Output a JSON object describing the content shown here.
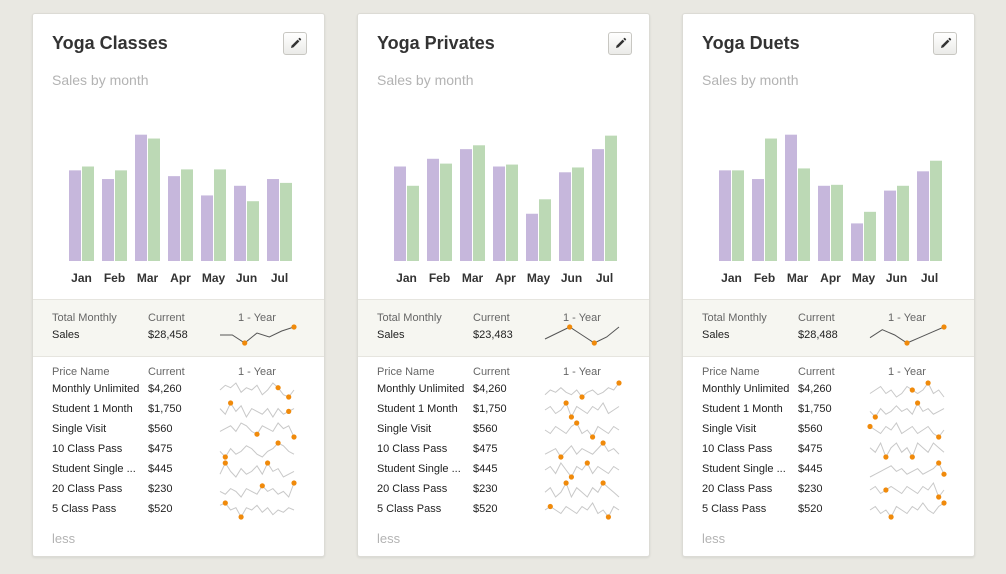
{
  "colors": {
    "current_bar": "#c6b7dc",
    "previous_bar": "#bcd9b5",
    "spark_line": "#555555",
    "spark_line_light": "#c8c8c8",
    "spark_dot": "#f08a0b"
  },
  "icons": {
    "edit": "pencil-icon"
  },
  "cards": [
    {
      "title": "Yoga Classes",
      "subtitle": "Sales by month",
      "chart_data": {
        "type": "bar",
        "categories": [
          "Jan",
          "Feb",
          "Mar",
          "Apr",
          "May",
          "Jun",
          "Jul"
        ],
        "series": [
          {
            "values": [
              94,
              85,
              131,
              88,
              68,
              78,
              85
            ]
          },
          {
            "values": [
              98,
              94,
              127,
              95,
              95,
              62,
              81
            ]
          }
        ],
        "ylim": [
          0,
          140
        ]
      },
      "summary": {
        "label_line1": "Total Monthly",
        "label_line2": "Sales",
        "current_header": "Current",
        "current_value": "$28,458",
        "trend_header": "1 - Year",
        "trend": [
          6,
          6,
          2,
          7,
          5,
          8,
          10
        ]
      },
      "price_list": {
        "name_header": "Price Name",
        "current_header": "Current",
        "trend_header": "1 - Year",
        "rows": [
          {
            "name": "Monthly Unlimited",
            "value": "$4,260",
            "trend": [
              5,
              7,
              6,
              8,
              4,
              6,
              5,
              7,
              3,
              5,
              8,
              6,
              3,
              2,
              5
            ],
            "highlight": [
              11,
              13
            ]
          },
          {
            "name": "Student 1 Month",
            "value": "$1,750",
            "trend": [
              6,
              4,
              8,
              5,
              7,
              3,
              6,
              5,
              4,
              6,
              3,
              6,
              4,
              5,
              6
            ],
            "highlight": [
              2,
              13
            ]
          },
          {
            "name": "Single Visit",
            "value": "$560",
            "trend": [
              4,
              5,
              6,
              4,
              7,
              6,
              4,
              3,
              6,
              5,
              4,
              7,
              5,
              6,
              2
            ],
            "highlight": [
              7,
              14
            ]
          },
          {
            "name": "10 Class Pass",
            "value": "$475",
            "trend": [
              5,
              3,
              6,
              4,
              5,
              7,
              6,
              4,
              3,
              5,
              6,
              8,
              7,
              5,
              4
            ],
            "highlight": [
              1,
              11
            ]
          },
          {
            "name": "Student Single ...",
            "value": "$445",
            "trend": [
              4,
              8,
              5,
              3,
              6,
              4,
              5,
              7,
              4,
              8,
              5,
              6,
              3,
              4,
              5
            ],
            "highlight": [
              1,
              9
            ]
          },
          {
            "name": "20 Class Pass",
            "value": "$230",
            "trend": [
              5,
              4,
              6,
              5,
              3,
              6,
              5,
              4,
              7,
              5,
              6,
              4,
              5,
              3,
              8
            ],
            "highlight": [
              8,
              14
            ]
          },
          {
            "name": "5 Class Pass",
            "value": "$520",
            "trend": [
              7,
              8,
              5,
              6,
              2,
              6,
              5,
              7,
              4,
              6,
              3,
              5,
              4,
              6,
              5
            ],
            "highlight": [
              4,
              1
            ]
          }
        ]
      },
      "less_label": "less"
    },
    {
      "title": "Yoga Privates",
      "subtitle": "Sales by month",
      "chart_data": {
        "type": "bar",
        "categories": [
          "Jan",
          "Feb",
          "Mar",
          "Apr",
          "May",
          "Jun",
          "Jul"
        ],
        "series": [
          {
            "values": [
              98,
              106,
              116,
              98,
              49,
              92,
              116
            ]
          },
          {
            "values": [
              78,
              101,
              120,
              100,
              64,
              97,
              130
            ]
          }
        ],
        "ylim": [
          0,
          140
        ]
      },
      "summary": {
        "label_line1": "Total Monthly",
        "label_line2": "Sales",
        "current_header": "Current",
        "current_value": "$23,483",
        "trend_header": "1 - Year",
        "trend": [
          4,
          7,
          10,
          6,
          2,
          5,
          10
        ]
      },
      "price_list": {
        "name_header": "Price Name",
        "current_header": "Current",
        "trend_header": "1 - Year",
        "rows": [
          {
            "name": "Monthly Unlimited",
            "value": "$4,260",
            "trend": [
              4,
              6,
              5,
              7,
              5,
              4,
              6,
              3,
              5,
              6,
              4,
              5,
              7,
              6,
              9
            ],
            "highlight": [
              14,
              7
            ]
          },
          {
            "name": "Student 1 Month",
            "value": "$1,750",
            "trend": [
              5,
              6,
              4,
              5,
              7,
              3,
              6,
              5,
              4,
              6,
              5,
              7,
              4,
              5,
              6
            ],
            "highlight": [
              5,
              4
            ]
          },
          {
            "name": "Single Visit",
            "value": "$560",
            "trend": [
              5,
              4,
              6,
              5,
              4,
              6,
              7,
              4,
              5,
              3,
              6,
              5,
              4,
              6,
              5
            ],
            "highlight": [
              6,
              9
            ]
          },
          {
            "name": "10 Class Pass",
            "value": "$475",
            "trend": [
              4,
              5,
              6,
              3,
              5,
              7,
              4,
              6,
              5,
              4,
              6,
              8,
              5,
              6,
              4
            ],
            "highlight": [
              3,
              11
            ]
          },
          {
            "name": "Student Single ...",
            "value": "$445",
            "trend": [
              5,
              6,
              4,
              7,
              5,
              3,
              6,
              5,
              7,
              4,
              6,
              5,
              4,
              6,
              5
            ],
            "highlight": [
              5,
              8
            ]
          },
          {
            "name": "20 Class Pass",
            "value": "$230",
            "trend": [
              5,
              6,
              4,
              5,
              7,
              4,
              6,
              5,
              4,
              6,
              5,
              7,
              6,
              5,
              4
            ],
            "highlight": [
              4,
              11
            ]
          },
          {
            "name": "5 Class Pass",
            "value": "$520",
            "trend": [
              5,
              6,
              5,
              4,
              6,
              5,
              4,
              6,
              5,
              7,
              4,
              5,
              3,
              6,
              5
            ],
            "highlight": [
              1,
              12
            ]
          }
        ]
      },
      "less_label": "less"
    },
    {
      "title": "Yoga Duets",
      "subtitle": "Sales by month",
      "chart_data": {
        "type": "bar",
        "categories": [
          "Jan",
          "Feb",
          "Mar",
          "Apr",
          "May",
          "Jun",
          "Jul"
        ],
        "series": [
          {
            "values": [
              94,
              85,
              131,
              78,
              39,
              73,
              93
            ]
          },
          {
            "values": [
              94,
              127,
              96,
              79,
              51,
              78,
              104
            ]
          }
        ],
        "ylim": [
          0,
          140
        ]
      },
      "summary": {
        "label_line1": "Total Monthly",
        "label_line2": "Sales",
        "current_header": "Current",
        "current_value": "$28,488",
        "trend_header": "1 - Year",
        "trend": [
          6,
          9,
          7,
          4,
          6,
          8,
          10
        ]
      },
      "price_list": {
        "name_header": "Price Name",
        "current_header": "Current",
        "trend_header": "1 - Year",
        "rows": [
          {
            "name": "Monthly Unlimited",
            "value": "$4,260",
            "trend": [
              5,
              6,
              7,
              5,
              6,
              4,
              5,
              7,
              6,
              5,
              6,
              8,
              5,
              6,
              4
            ],
            "highlight": [
              8,
              11
            ]
          },
          {
            "name": "Student 1 Month",
            "value": "$1,750",
            "trend": [
              5,
              3,
              6,
              4,
              5,
              7,
              5,
              6,
              4,
              8,
              5,
              6,
              4,
              5,
              6
            ],
            "highlight": [
              9,
              1
            ]
          },
          {
            "name": "Single Visit",
            "value": "$560",
            "trend": [
              6,
              5,
              4,
              6,
              5,
              7,
              4,
              5,
              6,
              4,
              5,
              6,
              4,
              3,
              5
            ],
            "highlight": [
              0,
              13
            ]
          },
          {
            "name": "10 Class Pass",
            "value": "$475",
            "trend": [
              5,
              4,
              6,
              3,
              5,
              6,
              4,
              5,
              3,
              6,
              5,
              4,
              6,
              5,
              4
            ],
            "highlight": [
              3,
              8
            ]
          },
          {
            "name": "Student Single ...",
            "value": "$445",
            "trend": [
              3,
              4,
              5,
              6,
              7,
              5,
              6,
              4,
              5,
              6,
              4,
              5,
              6,
              8,
              4
            ],
            "highlight": [
              13,
              14
            ]
          },
          {
            "name": "20 Class Pass",
            "value": "$230",
            "trend": [
              5,
              6,
              4,
              5,
              6,
              5,
              4,
              6,
              5,
              4,
              6,
              5,
              7,
              3,
              5
            ],
            "highlight": [
              3,
              13
            ]
          },
          {
            "name": "5 Class Pass",
            "value": "$520",
            "trend": [
              5,
              6,
              4,
              5,
              3,
              6,
              5,
              4,
              6,
              5,
              7,
              5,
              4,
              6,
              7
            ],
            "highlight": [
              4,
              14
            ]
          }
        ]
      },
      "less_label": "less"
    }
  ]
}
